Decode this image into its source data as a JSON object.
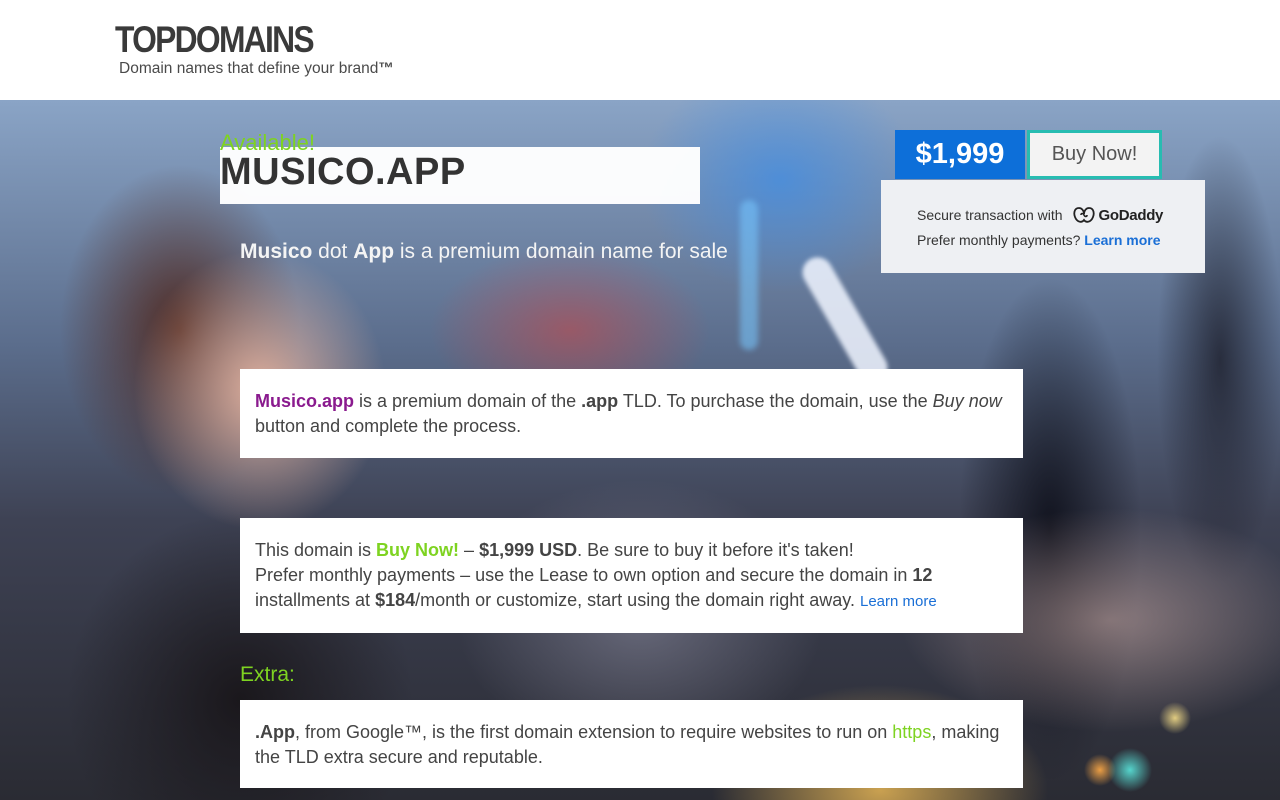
{
  "header": {
    "logo": "TOPDOMAINS",
    "tagline": "Domain names that define your brand",
    "tagline_mark": "™"
  },
  "hero": {
    "available": "Available!",
    "domain_name": "MUSICO.APP",
    "subtitle": {
      "part1": "Musico",
      "part2": " dot ",
      "part3": "App",
      "part4": " is a premium domain name for sale"
    }
  },
  "purchase": {
    "price": "$1,999",
    "buy_label": "Buy Now!",
    "secure_text": "Secure transaction with",
    "provider": "GoDaddy",
    "monthly_text": "Prefer monthly payments?",
    "learn_more": "Learn more"
  },
  "box1": {
    "domain": "Musico.app",
    "t1": " is a premium domain of the ",
    "tld": ".app",
    "t2": " TLD. To purchase the domain, use the ",
    "buy_now": "Buy now",
    "t3": " button and complete the process."
  },
  "box2": {
    "t1": "This domain is ",
    "status": "Buy Now!",
    "t2": " – ",
    "price": "$1,999 USD",
    "t3": ". Be sure to buy it before it's taken!",
    "t4": "Prefer monthly payments – use the Lease to own option and secure the domain in ",
    "installments": "12",
    "t5": " installments at ",
    "monthly": "$184",
    "t6": "/month or customize, start using the domain right away. ",
    "learn_more": "Learn more"
  },
  "extra": {
    "heading": "Extra:",
    "tld": ".App",
    "t1": ", from Google™, is the first domain extension to require websites to run on ",
    "https": "https",
    "t2": ", making the TLD extra secure and reputable."
  },
  "colors": {
    "accent_green": "#7ed321",
    "price_blue": "#0d6fd9",
    "button_border": "#27bcb1",
    "domain_purple": "#8a1a8e",
    "link_blue": "#1a6fd6"
  }
}
